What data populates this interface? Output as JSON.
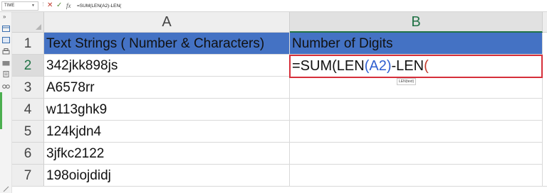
{
  "formula_bar": {
    "name_box": "TIME",
    "cancel_symbol": "✕",
    "enter_symbol": "✓",
    "fx_label": "fx",
    "formula": "=SUM(LEN(A2)-LEN("
  },
  "columns": [
    "A",
    "B"
  ],
  "rows": [
    "1",
    "2",
    "3",
    "4",
    "5",
    "6",
    "7"
  ],
  "sheet": {
    "header_a": "Text Strings ( Number & Characters)",
    "header_b": "Number of Digits",
    "values": [
      "342jkk898js",
      "A6578rr",
      "w113ghk9",
      "124kjdn4",
      "3jfkc2122",
      "198oiojdidj"
    ]
  },
  "active_cell": {
    "part1": "=SUM(LEN",
    "part2": "(",
    "part3": "A2",
    "part4": ")",
    "part5": "-LEN",
    "part6": "("
  },
  "tooltip": "LEN(text)",
  "colors": {
    "header_fill": "#4472c4",
    "active_border": "#d62f3a",
    "cell_ref": "#2f5fd0"
  }
}
